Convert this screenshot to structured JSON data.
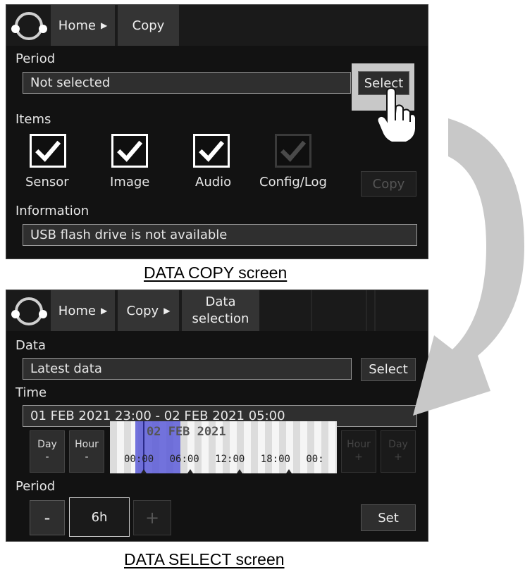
{
  "copy_screen": {
    "breadcrumb": {
      "home": "Home",
      "copy": "Copy"
    },
    "period": {
      "label": "Period",
      "value": "Not selected",
      "select_button": "Select"
    },
    "items": {
      "label": "Items",
      "checkboxes": [
        {
          "label": "Sensor",
          "checked": true,
          "enabled": true
        },
        {
          "label": "Image",
          "checked": true,
          "enabled": true
        },
        {
          "label": "Audio",
          "checked": true,
          "enabled": true
        },
        {
          "label": "Config/Log",
          "checked": true,
          "enabled": false
        }
      ],
      "copy_button": "Copy"
    },
    "information": {
      "label": "Information",
      "value": "USB flash drive is not available"
    }
  },
  "select_screen": {
    "breadcrumb": {
      "home": "Home",
      "copy": "Copy",
      "data_selection_line1": "Data",
      "data_selection_line2": "selection"
    },
    "data": {
      "label": "Data",
      "value": "Latest data",
      "select_button": "Select"
    },
    "time": {
      "label": "Time",
      "value": "01 FEB 2021 23:00 - 02 FEB 2021 05:00"
    },
    "nav": {
      "day_back": {
        "line1": "Day",
        "line2": "-"
      },
      "hour_back": {
        "line1": "Hour",
        "line2": "-"
      },
      "hour_forward": {
        "line1": "Hour",
        "line2": "+"
      },
      "day_forward": {
        "line1": "Day",
        "line2": "+"
      }
    },
    "timeline": {
      "date": "02 FEB 2021",
      "hours": [
        "00:00",
        "06:00",
        "12:00",
        "18:00",
        "00:"
      ]
    },
    "period": {
      "label": "Period",
      "minus": "-",
      "value": "6h",
      "plus": "+",
      "set_button": "Set"
    }
  },
  "captions": {
    "copy": "DATA COPY screen",
    "select": "DATA SELECT screen"
  },
  "colors": {
    "screen_bg": "#121212",
    "tab_bg": "#343434",
    "selection": "#5a5ad7",
    "arrow": "#c8c8c8",
    "highlight": "#c8c8c8"
  }
}
